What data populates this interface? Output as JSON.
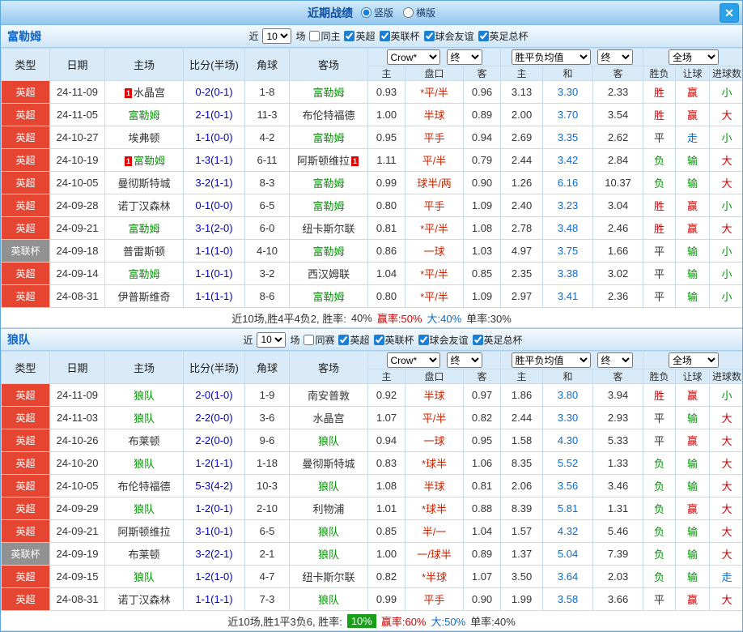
{
  "titlebar": {
    "title": "近期战绩",
    "radio_options": [
      {
        "label": "竖版",
        "selected": true
      },
      {
        "label": "横版",
        "selected": false
      }
    ],
    "close_icon": "✕"
  },
  "table": {
    "main_headers": [
      "类型",
      "日期",
      "主场",
      "比分(半场)",
      "角球",
      "客场"
    ],
    "odds_select": "Crow*",
    "odds_final_select": "终",
    "avg_select": "胜平负均值",
    "avg_final_select": "终",
    "scope_select": "全场",
    "sub_headers": [
      "主",
      "盘口",
      "客",
      "主",
      "和",
      "客",
      "胜负",
      "让球",
      "进球数"
    ]
  },
  "filter": {
    "near_label": "近",
    "count": "10",
    "games_label": "场",
    "same_checked": false,
    "league_options": [
      "英超",
      "英联杯",
      "球会友谊",
      "英足总杯"
    ],
    "league_checked": true
  },
  "colors": {
    "team_green": "#009b00",
    "opponent_dark": "#333333",
    "score_blue": "#0000cc",
    "handicap_red": "#cc2200",
    "draw_blue": "#0a6ccc",
    "win_red": "#d40000",
    "lose_green": "#009900",
    "walk_blue": "#0a6ccc",
    "neutral": "#333333",
    "league_red": "#e64531",
    "league_gray": "#919191",
    "highlight_green": "#18a018"
  },
  "sections": [
    {
      "team": "富勒姆",
      "same_label": "同主",
      "rows": [
        {
          "league": "英超",
          "league_style": "red",
          "date": "24-11-09",
          "home": "水晶宫",
          "home_card": "1",
          "score": "0-2(0-1)",
          "corner": "1-8",
          "away": "富勒姆",
          "away_card": "",
          "odds_home": "0.93",
          "handicap": "*平/半",
          "odds_away": "0.96",
          "avg_home": "3.13",
          "avg_draw": "3.30",
          "avg_away": "2.33",
          "result": "胜",
          "handicap_result": "赢",
          "goals": "小"
        },
        {
          "league": "英超",
          "league_style": "red",
          "date": "24-11-05",
          "home": "富勒姆",
          "home_card": "",
          "score": "2-1(0-1)",
          "corner": "11-3",
          "away": "布伦特福德",
          "away_card": "",
          "odds_home": "1.00",
          "handicap": "半球",
          "odds_away": "0.89",
          "avg_home": "2.00",
          "avg_draw": "3.70",
          "avg_away": "3.54",
          "result": "胜",
          "handicap_result": "赢",
          "goals": "大"
        },
        {
          "league": "英超",
          "league_style": "red",
          "date": "24-10-27",
          "home": "埃弗顿",
          "home_card": "",
          "score": "1-1(0-0)",
          "corner": "4-2",
          "away": "富勒姆",
          "away_card": "",
          "odds_home": "0.95",
          "handicap": "平手",
          "odds_away": "0.94",
          "avg_home": "2.69",
          "avg_draw": "3.35",
          "avg_away": "2.62",
          "result": "平",
          "handicap_result": "走",
          "goals": "小"
        },
        {
          "league": "英超",
          "league_style": "red",
          "date": "24-10-19",
          "home": "富勒姆",
          "home_card": "1",
          "score": "1-3(1-1)",
          "corner": "6-11",
          "away": "阿斯顿维拉",
          "away_card": "1",
          "odds_home": "1.11",
          "handicap": "平/半",
          "odds_away": "0.79",
          "avg_home": "2.44",
          "avg_draw": "3.42",
          "avg_away": "2.84",
          "result": "负",
          "handicap_result": "输",
          "goals": "大"
        },
        {
          "league": "英超",
          "league_style": "red",
          "date": "24-10-05",
          "home": "曼彻斯特城",
          "home_card": "",
          "score": "3-2(1-1)",
          "corner": "8-3",
          "away": "富勒姆",
          "away_card": "",
          "odds_home": "0.99",
          "handicap": "球半/两",
          "odds_away": "0.90",
          "avg_home": "1.26",
          "avg_draw": "6.16",
          "avg_away": "10.37",
          "result": "负",
          "handicap_result": "输",
          "goals": "大"
        },
        {
          "league": "英超",
          "league_style": "red",
          "date": "24-09-28",
          "home": "诺丁汉森林",
          "home_card": "",
          "score": "0-1(0-0)",
          "corner": "6-5",
          "away": "富勒姆",
          "away_card": "",
          "odds_home": "0.80",
          "handicap": "平手",
          "odds_away": "1.09",
          "avg_home": "2.40",
          "avg_draw": "3.23",
          "avg_away": "3.04",
          "result": "胜",
          "handicap_result": "赢",
          "goals": "小"
        },
        {
          "league": "英超",
          "league_style": "red",
          "date": "24-09-21",
          "home": "富勒姆",
          "home_card": "",
          "score": "3-1(2-0)",
          "corner": "6-0",
          "away": "纽卡斯尔联",
          "away_card": "",
          "odds_home": "0.81",
          "handicap": "*平/半",
          "odds_away": "1.08",
          "avg_home": "2.78",
          "avg_draw": "3.48",
          "avg_away": "2.46",
          "result": "胜",
          "handicap_result": "赢",
          "goals": "大"
        },
        {
          "league": "英联杯",
          "league_style": "gray",
          "date": "24-09-18",
          "home": "普雷斯顿",
          "home_card": "",
          "score": "1-1(1-0)",
          "corner": "4-10",
          "away": "富勒姆",
          "away_card": "",
          "odds_home": "0.86",
          "handicap": "一球",
          "odds_away": "1.03",
          "avg_home": "4.97",
          "avg_draw": "3.75",
          "avg_away": "1.66",
          "result": "平",
          "handicap_result": "输",
          "goals": "小"
        },
        {
          "league": "英超",
          "league_style": "red",
          "date": "24-09-14",
          "home": "富勒姆",
          "home_card": "",
          "score": "1-1(0-1)",
          "corner": "3-2",
          "away": "西汉姆联",
          "away_card": "",
          "odds_home": "1.04",
          "handicap": "*平/半",
          "odds_away": "0.85",
          "avg_home": "2.35",
          "avg_draw": "3.38",
          "avg_away": "3.02",
          "result": "平",
          "handicap_result": "输",
          "goals": "小"
        },
        {
          "league": "英超",
          "league_style": "red",
          "date": "24-08-31",
          "home": "伊普斯维奇",
          "home_card": "",
          "score": "1-1(1-1)",
          "corner": "8-6",
          "away": "富勒姆",
          "away_card": "",
          "odds_home": "0.80",
          "handicap": "*平/半",
          "odds_away": "1.09",
          "avg_home": "2.97",
          "avg_draw": "3.41",
          "avg_away": "2.36",
          "result": "平",
          "handicap_result": "输",
          "goals": "小"
        }
      ],
      "summary": {
        "prefix": "近10场,胜4平4负2, 胜率:",
        "win_rate": "40%",
        "win_rate_highlight": false,
        "win_text": "赢率:50%",
        "big_text": "大:40%",
        "single_text": "单率:30%"
      }
    },
    {
      "team": "狼队",
      "same_label": "同赛",
      "rows": [
        {
          "league": "英超",
          "league_style": "red",
          "date": "24-11-09",
          "home": "狼队",
          "home_card": "",
          "score": "2-0(1-0)",
          "corner": "1-9",
          "away": "南安普敦",
          "away_card": "",
          "odds_home": "0.92",
          "handicap": "半球",
          "odds_away": "0.97",
          "avg_home": "1.86",
          "avg_draw": "3.80",
          "avg_away": "3.94",
          "result": "胜",
          "handicap_result": "赢",
          "goals": "小"
        },
        {
          "league": "英超",
          "league_style": "red",
          "date": "24-11-03",
          "home": "狼队",
          "home_card": "",
          "score": "2-2(0-0)",
          "corner": "3-6",
          "away": "水晶宫",
          "away_card": "",
          "odds_home": "1.07",
          "handicap": "平/半",
          "odds_away": "0.82",
          "avg_home": "2.44",
          "avg_draw": "3.30",
          "avg_away": "2.93",
          "result": "平",
          "handicap_result": "输",
          "goals": "大"
        },
        {
          "league": "英超",
          "league_style": "red",
          "date": "24-10-26",
          "home": "布莱顿",
          "home_card": "",
          "score": "2-2(0-0)",
          "corner": "9-6",
          "away": "狼队",
          "away_card": "",
          "odds_home": "0.94",
          "handicap": "一球",
          "odds_away": "0.95",
          "avg_home": "1.58",
          "avg_draw": "4.30",
          "avg_away": "5.33",
          "result": "平",
          "handicap_result": "赢",
          "goals": "大"
        },
        {
          "league": "英超",
          "league_style": "red",
          "date": "24-10-20",
          "home": "狼队",
          "home_card": "",
          "score": "1-2(1-1)",
          "corner": "1-18",
          "away": "曼彻斯特城",
          "away_card": "",
          "odds_home": "0.83",
          "handicap": "*球半",
          "odds_away": "1.06",
          "avg_home": "8.35",
          "avg_draw": "5.52",
          "avg_away": "1.33",
          "result": "负",
          "handicap_result": "输",
          "goals": "大"
        },
        {
          "league": "英超",
          "league_style": "red",
          "date": "24-10-05",
          "home": "布伦特福德",
          "home_card": "",
          "score": "5-3(4-2)",
          "corner": "10-3",
          "away": "狼队",
          "away_card": "",
          "odds_home": "1.08",
          "handicap": "半球",
          "odds_away": "0.81",
          "avg_home": "2.06",
          "avg_draw": "3.56",
          "avg_away": "3.46",
          "result": "负",
          "handicap_result": "输",
          "goals": "大"
        },
        {
          "league": "英超",
          "league_style": "red",
          "date": "24-09-29",
          "home": "狼队",
          "home_card": "",
          "score": "1-2(0-1)",
          "corner": "2-10",
          "away": "利物浦",
          "away_card": "",
          "odds_home": "1.01",
          "handicap": "*球半",
          "odds_away": "0.88",
          "avg_home": "8.39",
          "avg_draw": "5.81",
          "avg_away": "1.31",
          "result": "负",
          "handicap_result": "赢",
          "goals": "大"
        },
        {
          "league": "英超",
          "league_style": "red",
          "date": "24-09-21",
          "home": "阿斯顿维拉",
          "home_card": "",
          "score": "3-1(0-1)",
          "corner": "6-5",
          "away": "狼队",
          "away_card": "",
          "odds_home": "0.85",
          "handicap": "半/一",
          "odds_away": "1.04",
          "avg_home": "1.57",
          "avg_draw": "4.32",
          "avg_away": "5.46",
          "result": "负",
          "handicap_result": "输",
          "goals": "大"
        },
        {
          "league": "英联杯",
          "league_style": "gray",
          "date": "24-09-19",
          "home": "布莱顿",
          "home_card": "",
          "score": "3-2(2-1)",
          "corner": "2-1",
          "away": "狼队",
          "away_card": "",
          "odds_home": "1.00",
          "handicap": "一/球半",
          "odds_away": "0.89",
          "avg_home": "1.37",
          "avg_draw": "5.04",
          "avg_away": "7.39",
          "result": "负",
          "handicap_result": "输",
          "goals": "大"
        },
        {
          "league": "英超",
          "league_style": "red",
          "date": "24-09-15",
          "home": "狼队",
          "home_card": "",
          "score": "1-2(1-0)",
          "corner": "4-7",
          "away": "纽卡斯尔联",
          "away_card": "",
          "odds_home": "0.82",
          "handicap": "*半球",
          "odds_away": "1.07",
          "avg_home": "3.50",
          "avg_draw": "3.64",
          "avg_away": "2.03",
          "result": "负",
          "handicap_result": "输",
          "goals": "走"
        },
        {
          "league": "英超",
          "league_style": "red",
          "date": "24-08-31",
          "home": "诺丁汉森林",
          "home_card": "",
          "score": "1-1(1-1)",
          "corner": "7-3",
          "away": "狼队",
          "away_card": "",
          "odds_home": "0.99",
          "handicap": "平手",
          "odds_away": "0.90",
          "avg_home": "1.99",
          "avg_draw": "3.58",
          "avg_away": "3.66",
          "result": "平",
          "handicap_result": "赢",
          "goals": "大"
        }
      ],
      "summary": {
        "prefix": "近10场,胜1平3负6, 胜率:",
        "win_rate": "10%",
        "win_rate_highlight": true,
        "win_text": "赢率:60%",
        "big_text": "大:50%",
        "single_text": "单率:40%"
      }
    }
  ]
}
